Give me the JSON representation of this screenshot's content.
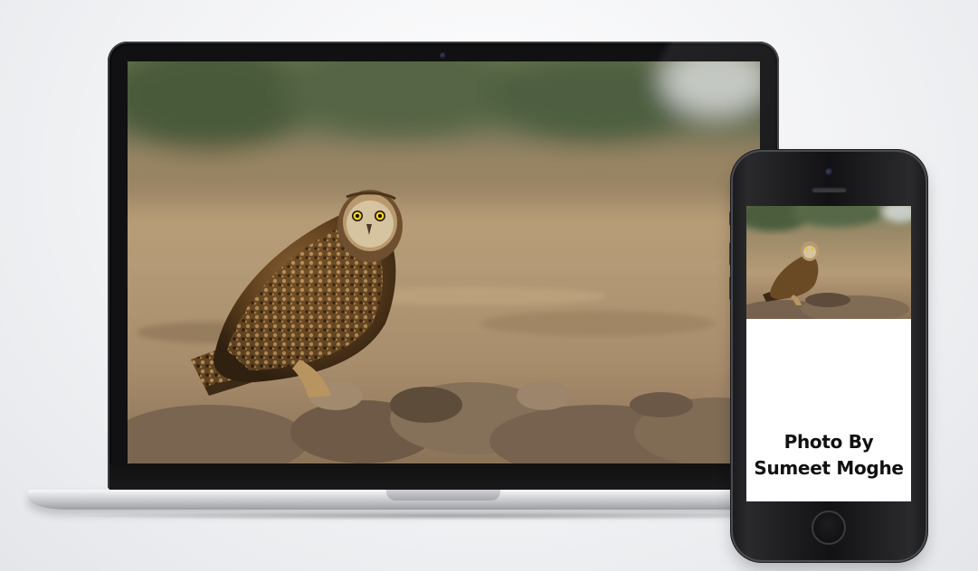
{
  "scene": {
    "description_free": true
  },
  "laptop": {
    "photo_subject": "owl-photo"
  },
  "phone": {
    "caption_line1": "Photo By",
    "caption_line2": "Sumeet Moghe"
  }
}
